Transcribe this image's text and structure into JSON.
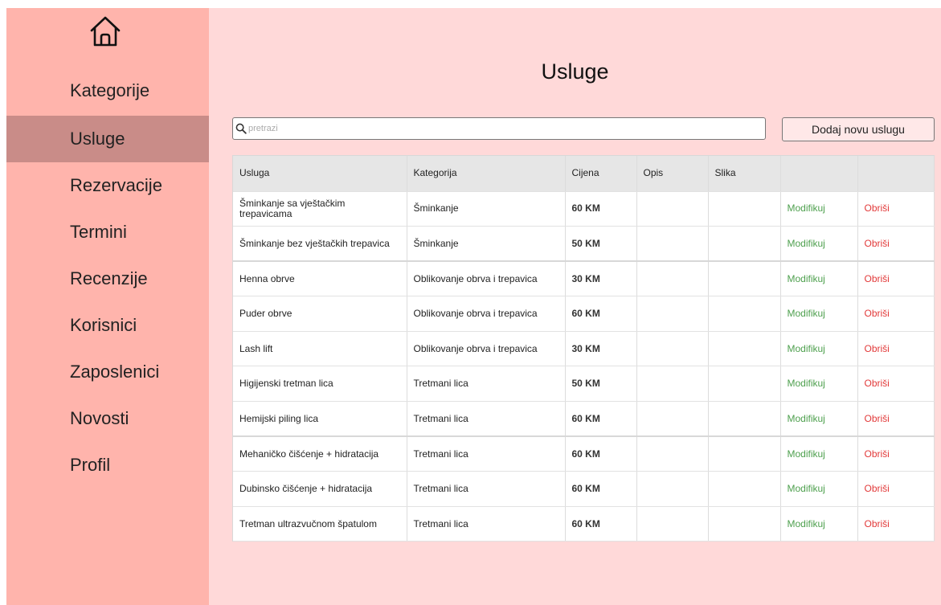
{
  "sidebar": {
    "home_icon": "home-icon",
    "items": [
      {
        "label": "Kategorije",
        "active": false
      },
      {
        "label": "Usluge",
        "active": true
      },
      {
        "label": "Rezervacije",
        "active": false
      },
      {
        "label": "Termini",
        "active": false
      },
      {
        "label": "Recenzije",
        "active": false
      },
      {
        "label": "Korisnici",
        "active": false
      },
      {
        "label": "Zaposlenici",
        "active": false
      },
      {
        "label": "Novosti",
        "active": false
      },
      {
        "label": "Profil",
        "active": false
      }
    ]
  },
  "main": {
    "title": "Usluge",
    "search": {
      "placeholder": "pretrazi",
      "value": "",
      "icon": "search-icon"
    },
    "add_button": "Dodaj novu uslugu",
    "table": {
      "headers": [
        "Usluga",
        "Kategorija",
        "Cijena",
        "Opis",
        "Slika",
        "",
        ""
      ],
      "rows": [
        {
          "usluga": "Šminkanje sa vještačkim trepavicama",
          "kategorija": "Šminkanje",
          "cijena": "60 KM",
          "opis": "",
          "slika": "",
          "modify": "Modifikuj",
          "delete": "Obriši"
        },
        {
          "usluga": "Šminkanje bez vještačkih trepavica",
          "kategorija": "Šminkanje",
          "cijena": "50 KM",
          "opis": "",
          "slika": "",
          "modify": "Modifikuj",
          "delete": "Obriši"
        },
        {
          "usluga": "Henna obrve",
          "kategorija": "Oblikovanje obrva i trepavica",
          "cijena": "30 KM",
          "opis": "",
          "slika": "",
          "modify": "Modifikuj",
          "delete": "Obriši"
        },
        {
          "usluga": "Puder obrve",
          "kategorija": "Oblikovanje obrva i trepavica",
          "cijena": "60 KM",
          "opis": "",
          "slika": "",
          "modify": "Modifikuj",
          "delete": "Obriši"
        },
        {
          "usluga": "Lash lift",
          "kategorija": "Oblikovanje obrva i trepavica",
          "cijena": "30 KM",
          "opis": "",
          "slika": "",
          "modify": "Modifikuj",
          "delete": "Obriši"
        },
        {
          "usluga": "Higijenski tretman lica",
          "kategorija": "Tretmani lica",
          "cijena": "50 KM",
          "opis": "",
          "slika": "",
          "modify": "Modifikuj",
          "delete": "Obriši"
        },
        {
          "usluga": "Hemijski piling lica",
          "kategorija": "Tretmani lica",
          "cijena": "60 KM",
          "opis": "",
          "slika": "",
          "modify": "Modifikuj",
          "delete": "Obriši"
        },
        {
          "usluga": "Mehaničko čišćenje + hidratacija",
          "kategorija": "Tretmani lica",
          "cijena": "60 KM",
          "opis": "",
          "slika": "",
          "modify": "Modifikuj",
          "delete": "Obriši"
        },
        {
          "usluga": "Dubinsko čišćenje + hidratacija",
          "kategorija": "Tretmani lica",
          "cijena": "60 KM",
          "opis": "",
          "slika": "",
          "modify": "Modifikuj",
          "delete": "Obriši"
        },
        {
          "usluga": "Tretman ultrazvučnom špatulom",
          "kategorija": "Tretmani lica",
          "cijena": "60 KM",
          "opis": "",
          "slika": "",
          "modify": "Modifikuj",
          "delete": "Obriši"
        }
      ]
    }
  },
  "colors": {
    "sidebar_bg": "#ffb4ac",
    "sidebar_active": "#c98c88",
    "content_bg": "#ffd9d9",
    "modify": "#4ea04e",
    "delete": "#e23a3a"
  }
}
